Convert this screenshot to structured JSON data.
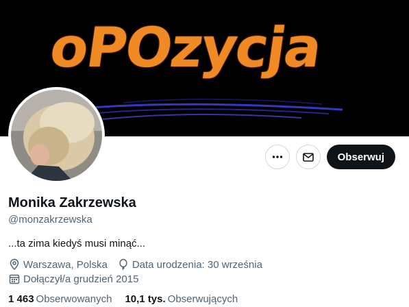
{
  "banner": {
    "title": "oPOzycja"
  },
  "actions": {
    "more_icon": "more-horizontal-icon",
    "message_icon": "envelope-icon",
    "follow_label": "Obserwuj"
  },
  "profile": {
    "name": "Monika Zakrzewska",
    "handle": "@monzakrzewska",
    "bio": "...ta zima kiedyś musi minąć...",
    "location": "Warszawa, Polska",
    "birthday": "Data urodzenia: 30 września",
    "joined": "Dołączył/a grudzień 2015"
  },
  "stats": {
    "following_count": "1 463",
    "following_label": "Obserwowanych",
    "followers_count": "10,1 tys.",
    "followers_label": "Obserwujących"
  },
  "colors": {
    "accent": "#0f1419",
    "muted": "#536471",
    "banner_text": "#f08a24"
  }
}
